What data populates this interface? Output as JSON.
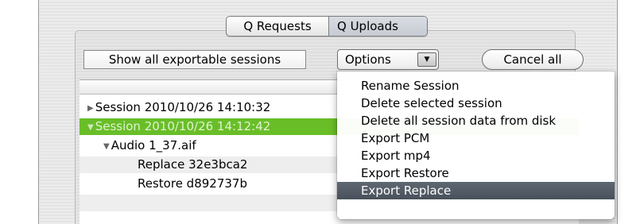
{
  "tabs": [
    {
      "label": "Q Requests",
      "selected": false
    },
    {
      "label": "Q Uploads",
      "selected": true
    }
  ],
  "toolbar": {
    "show_sessions_label": "Show all exportable sessions",
    "options_label": "Options",
    "cancel_label": "Cancel all"
  },
  "outline": {
    "rows": [
      {
        "label": "Session 2010/10/26 14:10:32",
        "expanded": false,
        "selected": false
      },
      {
        "label": "Session 2010/10/26 14:12:42",
        "expanded": true,
        "selected": true
      },
      {
        "label": "Audio 1_37.aif",
        "expanded": true,
        "selected": false
      },
      {
        "label": "Replace 32e3bca2",
        "selected": false
      },
      {
        "label": "Restore d892737b",
        "selected": false
      }
    ]
  },
  "options_menu": {
    "items": [
      {
        "label": "Rename Session"
      },
      {
        "label": "Delete selected session"
      },
      {
        "label": "Delete all session data from disk"
      },
      {
        "label": "Export PCM"
      },
      {
        "label": "Export mp4"
      },
      {
        "label": "Export Restore"
      },
      {
        "label": "Export Replace",
        "highlighted": true
      }
    ]
  },
  "colors": {
    "selection_green": "#69be28",
    "menu_highlight": "#525b65"
  }
}
